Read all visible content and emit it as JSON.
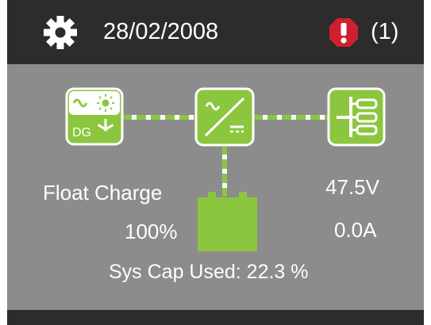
{
  "header": {
    "date": "28/02/2008",
    "alarm_count": "(1)",
    "settings_icon": "gear-icon",
    "alarm_icon": "alarm-octagon-icon"
  },
  "diagram": {
    "source_icon": "ac-solar-dg-wind-source-icon",
    "source_dg_label": "DG",
    "inverter_icon": "inverter-icon",
    "load_icon": "load-distribution-icon",
    "battery_icon": "battery-icon"
  },
  "status": {
    "mode": "Float Charge",
    "charge_percent": "100%",
    "voltage": "47.5V",
    "current": "0.0A",
    "sys_cap_used": "Sys Cap Used: 22.3 %"
  },
  "colors": {
    "background": "#8c8c8c",
    "bar": "#2c2c2c",
    "accent_green": "#8cc63f",
    "alarm_red": "#d0202e",
    "text": "#ffffff"
  }
}
